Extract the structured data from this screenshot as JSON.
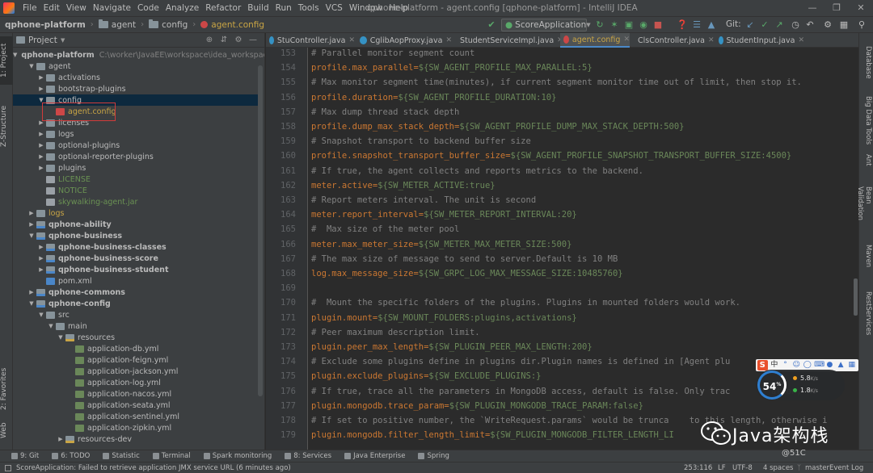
{
  "menu": {
    "items": [
      "File",
      "Edit",
      "View",
      "Navigate",
      "Code",
      "Analyze",
      "Refactor",
      "Build",
      "Run",
      "Tools",
      "VCS",
      "Window",
      "Help"
    ],
    "window_title": "qphone-platform - agent.config [qphone-platform] - IntelliJ IDEA"
  },
  "breadcrumbs": [
    "qphone-platform",
    "agent",
    "config",
    "agent.config"
  ],
  "toolbar": {
    "run_config": "ScoreApplication",
    "git_label": "Git:"
  },
  "left_strip": {
    "project_tab": "1: Project",
    "structure_tab": "Z-Structure",
    "favorites_tab": "2: Favorites",
    "web_tab": "Web"
  },
  "project_panel": {
    "title": "Project",
    "root_path": "C:\\worker\\JavaEE\\workspace\\idea_workspace\\qph",
    "tree": [
      {
        "label": "qphone-platform",
        "icon": "module",
        "depth": 0,
        "expanded": true,
        "bold": true,
        "path": true
      },
      {
        "label": "agent",
        "icon": "folder",
        "depth": 1,
        "expanded": true
      },
      {
        "label": "activations",
        "icon": "folder",
        "depth": 2,
        "expanded": false
      },
      {
        "label": "bootstrap-plugins",
        "icon": "folder",
        "depth": 2,
        "expanded": false
      },
      {
        "label": "config",
        "icon": "folder",
        "depth": 2,
        "expanded": true,
        "selected": true
      },
      {
        "label": "agent.config",
        "icon": "cfg",
        "depth": 3,
        "leaf": true,
        "color": "yellow"
      },
      {
        "label": "licenses",
        "icon": "folder",
        "depth": 2,
        "expanded": false
      },
      {
        "label": "logs",
        "icon": "folder",
        "depth": 2,
        "expanded": false
      },
      {
        "label": "optional-plugins",
        "icon": "folder",
        "depth": 2,
        "expanded": false
      },
      {
        "label": "optional-reporter-plugins",
        "icon": "folder",
        "depth": 2,
        "expanded": false
      },
      {
        "label": "plugins",
        "icon": "folder",
        "depth": 2,
        "expanded": false
      },
      {
        "label": "LICENSE",
        "icon": "file",
        "depth": 2,
        "leaf": true,
        "color": "green"
      },
      {
        "label": "NOTICE",
        "icon": "file",
        "depth": 2,
        "leaf": true,
        "color": "green"
      },
      {
        "label": "skywalking-agent.jar",
        "icon": "file",
        "depth": 2,
        "leaf": true,
        "color": "green"
      },
      {
        "label": "logs",
        "icon": "folder",
        "depth": 1,
        "expanded": false,
        "color": "yellow"
      },
      {
        "label": "qphone-ability",
        "icon": "module",
        "depth": 1,
        "expanded": false,
        "bold": true
      },
      {
        "label": "qphone-business",
        "icon": "module",
        "depth": 1,
        "expanded": true,
        "bold": true
      },
      {
        "label": "qphone-business-classes",
        "icon": "module",
        "depth": 2,
        "expanded": false,
        "bold": true
      },
      {
        "label": "qphone-business-score",
        "icon": "module",
        "depth": 2,
        "expanded": false,
        "bold": true
      },
      {
        "label": "qphone-business-student",
        "icon": "module",
        "depth": 2,
        "expanded": false,
        "bold": true
      },
      {
        "label": "pom.xml",
        "icon": "xml",
        "depth": 2,
        "leaf": true
      },
      {
        "label": "qphone-commons",
        "icon": "module",
        "depth": 1,
        "expanded": false,
        "bold": true
      },
      {
        "label": "qphone-config",
        "icon": "module",
        "depth": 1,
        "expanded": true,
        "bold": true
      },
      {
        "label": "src",
        "icon": "folder",
        "depth": 2,
        "expanded": true
      },
      {
        "label": "main",
        "icon": "folder",
        "depth": 3,
        "expanded": true
      },
      {
        "label": "resources",
        "icon": "res",
        "depth": 4,
        "expanded": true
      },
      {
        "label": "application-db.yml",
        "icon": "yml",
        "depth": 5,
        "leaf": true
      },
      {
        "label": "application-feign.yml",
        "icon": "yml",
        "depth": 5,
        "leaf": true
      },
      {
        "label": "application-jackson.yml",
        "icon": "yml",
        "depth": 5,
        "leaf": true
      },
      {
        "label": "application-log.yml",
        "icon": "yml",
        "depth": 5,
        "leaf": true
      },
      {
        "label": "application-nacos.yml",
        "icon": "yml",
        "depth": 5,
        "leaf": true
      },
      {
        "label": "application-seata.yml",
        "icon": "yml",
        "depth": 5,
        "leaf": true
      },
      {
        "label": "application-sentinel.yml",
        "icon": "yml",
        "depth": 5,
        "leaf": true
      },
      {
        "label": "application-zipkin.yml",
        "icon": "yml",
        "depth": 5,
        "leaf": true
      },
      {
        "label": "resources-dev",
        "icon": "res",
        "depth": 4,
        "expanded": false
      }
    ]
  },
  "editor": {
    "tabs": [
      {
        "label": "StuController.java",
        "icon": "class"
      },
      {
        "label": "CglibAopProxy.java",
        "icon": "class"
      },
      {
        "label": "StudentServiceImpl.java",
        "icon": "class"
      },
      {
        "label": "agent.config",
        "icon": "cfg",
        "active": true
      },
      {
        "label": "ClsController.java",
        "icon": "class"
      },
      {
        "label": "StudentInput.java",
        "icon": "class"
      }
    ],
    "lines": [
      {
        "n": "153",
        "kind": "comment",
        "text": "# Parallel monitor segment count"
      },
      {
        "n": "154",
        "kind": "prop",
        "key": "profile.max_parallel",
        "value": "${SW_AGENT_PROFILE_MAX_PARALLEL:5}"
      },
      {
        "n": "155",
        "kind": "comment",
        "text": "# Max monitor segment time(minutes), if current segment monitor time out of limit, then stop it."
      },
      {
        "n": "156",
        "kind": "prop",
        "key": "profile.duration",
        "value": "${SW_AGENT_PROFILE_DURATION:10}"
      },
      {
        "n": "157",
        "kind": "comment",
        "text": "# Max dump thread stack depth"
      },
      {
        "n": "158",
        "kind": "prop",
        "key": "profile.dump_max_stack_depth",
        "value": "${SW_AGENT_PROFILE_DUMP_MAX_STACK_DEPTH:500}"
      },
      {
        "n": "159",
        "kind": "comment",
        "text": "# Snapshot transport to backend buffer size"
      },
      {
        "n": "160",
        "kind": "prop",
        "key": "profile.snapshot_transport_buffer_size",
        "value": "${SW_AGENT_PROFILE_SNAPSHOT_TRANSPORT_BUFFER_SIZE:4500}"
      },
      {
        "n": "161",
        "kind": "comment",
        "text": "# If true, the agent collects and reports metrics to the backend."
      },
      {
        "n": "162",
        "kind": "prop",
        "key": "meter.active",
        "value": "${SW_METER_ACTIVE:true}"
      },
      {
        "n": "163",
        "kind": "comment",
        "text": "# Report meters interval. The unit is second"
      },
      {
        "n": "164",
        "kind": "prop",
        "key": "meter.report_interval",
        "value": "${SW_METER_REPORT_INTERVAL:20}"
      },
      {
        "n": "165",
        "kind": "comment",
        "text": "#  Max size of the meter pool"
      },
      {
        "n": "166",
        "kind": "prop",
        "key": "meter.max_meter_size",
        "value": "${SW_METER_MAX_METER_SIZE:500}"
      },
      {
        "n": "167",
        "kind": "comment",
        "text": "# The max size of message to send to server.Default is 10 MB"
      },
      {
        "n": "168",
        "kind": "prop",
        "key": "log.max_message_size",
        "value": "${SW_GRPC_LOG_MAX_MESSAGE_SIZE:10485760}"
      },
      {
        "n": "169",
        "kind": "blank",
        "text": ""
      },
      {
        "n": "170",
        "kind": "comment",
        "text": "#  Mount the specific folders of the plugins. Plugins in mounted folders would work."
      },
      {
        "n": "171",
        "kind": "prop",
        "key": "plugin.mount",
        "value": "${SW_MOUNT_FOLDERS:plugins,activations}"
      },
      {
        "n": "172",
        "kind": "comment",
        "text": "# Peer maximum description limit."
      },
      {
        "n": "173",
        "kind": "prop",
        "key": "plugin.peer_max_length",
        "value": "${SW_PLUGIN_PEER_MAX_LENGTH:200}"
      },
      {
        "n": "174",
        "kind": "comment",
        "text": "# Exclude some plugins define in plugins dir.Plugin names is defined in [Agent plu"
      },
      {
        "n": "175",
        "kind": "prop",
        "key": "plugin.exclude_plugins",
        "value": "${SW_EXCLUDE_PLUGINS:}"
      },
      {
        "n": "176",
        "kind": "comment",
        "text": "# If true, trace all the parameters in MongoDB access, default is false. Only trac        ation, nc"
      },
      {
        "n": "177",
        "kind": "prop",
        "key": "plugin.mongodb.trace_param",
        "value": "${SW_PLUGIN_MONGODB_TRACE_PARAM:false}"
      },
      {
        "n": "178",
        "kind": "comment",
        "text": "# If set to positive number, the `WriteRequest.params` would be trunca    to this length, otherwise i"
      },
      {
        "n": "179",
        "kind": "prop",
        "key": "plugin.mongodb.filter_length_limit",
        "value": "${SW_PLUGIN_MONGODB_FILTER_LENGTH_LI"
      }
    ]
  },
  "right_strip": [
    "Database",
    "Big Data Tools",
    "Ant",
    "Bean Validation",
    "Maven",
    "RestServices"
  ],
  "bottom_tools": [
    "9: Git",
    "6: TODO",
    "Statistic",
    "Terminal",
    "Spark monitoring",
    "8: Services",
    "Java Enterprise",
    "Spring"
  ],
  "status": {
    "message": "ScoreApplication: Failed to retrieve application JMX service URL (6 minutes ago)",
    "position": "253:116",
    "line_sep": "LF",
    "encoding": "UTF-8",
    "indent": "4 spaces",
    "branch": "master",
    "event_log": "Event Log"
  },
  "overlay": {
    "net_percent": "54",
    "net_percent_unit": "%",
    "up_rate": "5.8",
    "down_rate": "1.8",
    "rate_unit": "K/s",
    "watermark": "Java架构栈",
    "blog_tag": "@51C"
  },
  "colors": {
    "comment": "#808080",
    "key": "#cc7832",
    "value": "#6a8759",
    "background": "#2b2b2b",
    "panel": "#3c3f41",
    "selection": "#0d293e",
    "active_tab_underline": "#4a88c7"
  }
}
